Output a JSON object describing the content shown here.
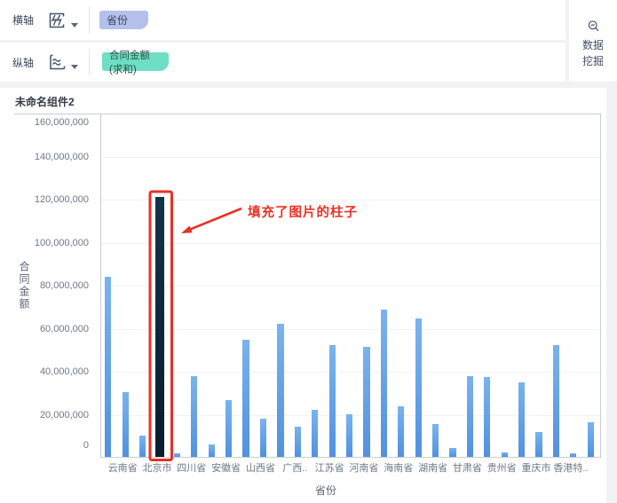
{
  "axis_config": {
    "rows": [
      {
        "label": "横轴",
        "icon": "dimension-axis-icon",
        "field": {
          "name": "省份",
          "type": "dimension"
        }
      },
      {
        "label": "纵轴",
        "icon": "measure-axis-icon",
        "field": {
          "name": "合同金额(求和)",
          "type": "measure"
        }
      }
    ]
  },
  "data_mining_panel": {
    "icon": "data-mining-search-icon",
    "line1": "数据",
    "line2": "挖掘"
  },
  "component": {
    "title": "未命名组件2"
  },
  "annotation": {
    "text": "填充了图片的柱子"
  },
  "colors": {
    "dimension_pill": "#b5c1ea",
    "measure_pill": "#6edec5",
    "bar_blue": "#66a4e8",
    "highlight_bar": "#0f2a3f",
    "annotation_red": "#e93125",
    "page_background": "#f0f2f5"
  },
  "chart_data": {
    "type": "bar",
    "title": "未命名组件2",
    "xlabel": "省份",
    "ylabel": "合同金额",
    "ylim": [
      0,
      160000000
    ],
    "ytick_interval": 20000000,
    "ytick_labels": [
      "160,000,000",
      "140,000,000",
      "120,000,000",
      "100,000,000",
      "80,000,000",
      "60,000,000",
      "40,000,000",
      "20,000,000",
      "0"
    ],
    "grid": true,
    "legend": "none",
    "categories": [
      "",
      "云南省",
      "",
      "北京市",
      "",
      "四川省",
      "",
      "安徽省",
      "",
      "山西省",
      "",
      "广西..",
      "",
      "江苏省",
      "",
      "河南省",
      "",
      "海南省",
      "",
      "湖南省",
      "",
      "甘肃省",
      "",
      "贵州省",
      "",
      "重庆市",
      "",
      "香港特..",
      ""
    ],
    "visible_category_labels": [
      "云南省",
      "北京市",
      "四川省",
      "安徽省",
      "山西省",
      "广西..",
      "江苏省",
      "河南省",
      "海南省",
      "湖南省",
      "甘肃省",
      "贵州省",
      "重庆市",
      "香港特.."
    ],
    "values": [
      84000000,
      30000000,
      10000000,
      121000000,
      1600000,
      37500000,
      6000000,
      26600000,
      54500000,
      18000000,
      62000000,
      14000000,
      21800000,
      52000000,
      20000000,
      51400000,
      68600000,
      23500000,
      64500000,
      15200000,
      4000000,
      37600000,
      37200000,
      2100000,
      34600000,
      11500000,
      52000000,
      1600000,
      16000000
    ],
    "highlighted_bar": {
      "index": 3,
      "category": "北京市",
      "value": 121000000,
      "style": "image-filled-dark-bar-with-red-outline",
      "note": "填充了图片的柱子"
    }
  }
}
